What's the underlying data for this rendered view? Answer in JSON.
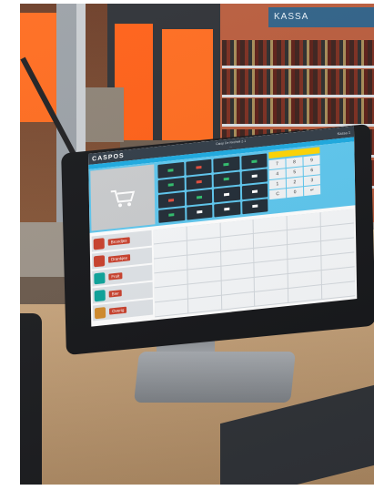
{
  "scene": {
    "store_sign": "KASSA"
  },
  "pos_screen": {
    "brand": "CASPOS",
    "top_center": [
      "Caisp De Rechtel 2.1",
      "..."
    ],
    "top_right": "Kassa 1",
    "categories": [
      {
        "label": "Broodjes",
        "icon": "bread-icon",
        "color": "#c93f2b"
      },
      {
        "label": "Drankjes",
        "icon": "drink-icon",
        "color": "#c93f2b"
      },
      {
        "label": "Fruit",
        "icon": "fruit-icon",
        "color": "#0aa39a"
      },
      {
        "label": "Bier",
        "icon": "beer-icon",
        "color": "#0aa39a"
      },
      {
        "label": "Overig",
        "icon": "misc-icon",
        "color": "#d28b2b"
      }
    ],
    "numpad_keys": [
      "7",
      "8",
      "9",
      "4",
      "5",
      "6",
      "1",
      "2",
      "3",
      "C",
      "0",
      "↵"
    ],
    "colors": {
      "topbar": "#2f3a45",
      "accent_blue": "#5cc6ee",
      "numpad_display": "#ffd400",
      "tile_dark": "#1f2a34"
    }
  }
}
